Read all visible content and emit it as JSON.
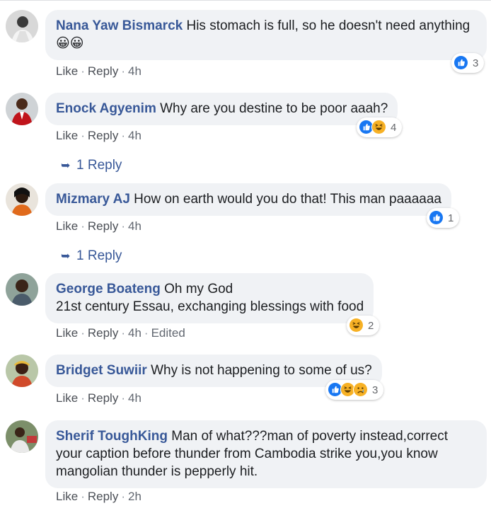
{
  "colors": {
    "name": "#385898",
    "bubble": "#f0f2f5",
    "meta": "#616770",
    "like_blue": "#1877f2",
    "haha_yellow": "#f7b125"
  },
  "comments": [
    {
      "author": "Nana Yaw Bismarck",
      "text": "His stomach is full, so he doesn't need anything 😀😀",
      "like": "Like",
      "reply": "Reply",
      "time": "4h",
      "edited": "",
      "reactions": [
        "like"
      ],
      "reaction_count": "3",
      "replies": ""
    },
    {
      "author": "Enock Agyenim",
      "text": "Why are you destine to be poor aaah?",
      "like": "Like",
      "reply": "Reply",
      "time": "4h",
      "edited": "",
      "reactions": [
        "like",
        "haha"
      ],
      "reaction_count": "4",
      "replies": "1 Reply"
    },
    {
      "author": "Mizmary AJ",
      "text": "How on earth would you do that! This man paaaaaa",
      "like": "Like",
      "reply": "Reply",
      "time": "4h",
      "edited": "",
      "reactions": [
        "like"
      ],
      "reaction_count": "1",
      "replies": "1 Reply"
    },
    {
      "author": "George Boateng",
      "text": "Oh my God",
      "text2": "21st century Essau, exchanging blessings with food",
      "like": "Like",
      "reply": "Reply",
      "time": "4h",
      "edited": "Edited",
      "reactions": [
        "haha"
      ],
      "reaction_count": "2",
      "replies": ""
    },
    {
      "author": "Bridget Suwiir",
      "text": "Why is not happening to some of us?",
      "like": "Like",
      "reply": "Reply",
      "time": "4h",
      "edited": "",
      "reactions": [
        "like",
        "haha",
        "sad"
      ],
      "reaction_count": "3",
      "replies": ""
    },
    {
      "author": "Sherif ToughKing",
      "text": "Man of what???man of poverty instead,correct your caption before thunder from Cambodia strike you,you know mangolian thunder is pepperly hit.",
      "like": "Like",
      "reply": "Reply",
      "time": "2h",
      "edited": "",
      "reactions": [],
      "reaction_count": "",
      "replies": ""
    }
  ]
}
